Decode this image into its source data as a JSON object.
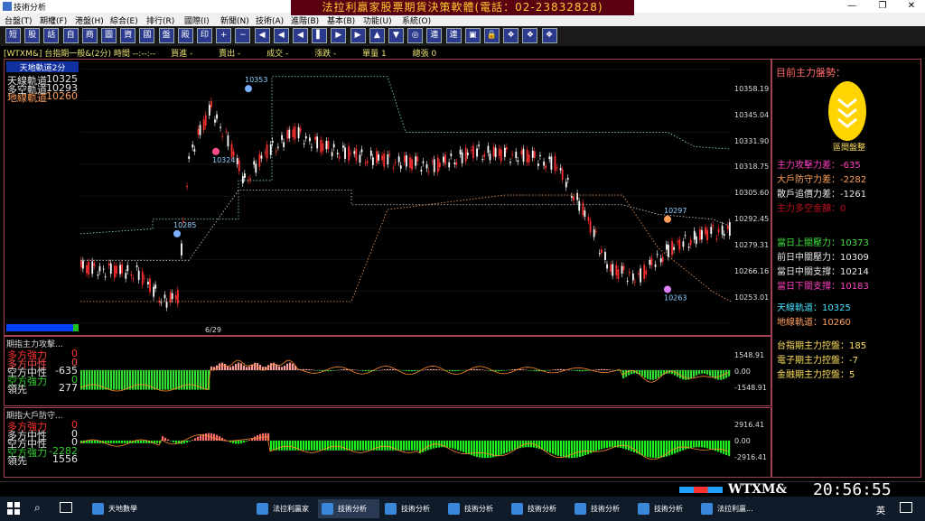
{
  "title": "技術分析",
  "banner": "法拉利贏家股票期貨決策軟體(電話：02-23832828)",
  "menu": [
    "台盤(T)",
    "期權(F)",
    "港盤(H)",
    "綜合(E)",
    "排行(R)",
    "國際(I)",
    "新聞(N)",
    "技術(A)",
    "進階(B)",
    "基本(B)",
    "功能(U)",
    "系統(O)"
  ],
  "toolbar": [
    "短",
    "股",
    "話",
    "自",
    "商",
    "圖",
    "資",
    "國",
    "盤",
    "殿",
    "印",
    "+",
    "−",
    "◀",
    "◀",
    "◀",
    "▌",
    "▶",
    "▶",
    "▲",
    "▼",
    "◎",
    "連",
    "連",
    "▣",
    "🔒",
    "❖",
    "❖",
    "❖"
  ],
  "info": {
    "symbol": "[WTXM&]",
    "name": "台指期一般&(2分) 時間 --:--:--",
    "buy": "買進 -",
    "sell": "賣出 -",
    "deal": "成交 -",
    "change": "漲跌 -",
    "volume": "單量 1",
    "total": "總張 0"
  },
  "main": {
    "legend_title": "天地軌道2分",
    "legend": [
      {
        "label": "天線軌道",
        "value": "10325",
        "color": "#e8e8e8"
      },
      {
        "label": "多空軌道",
        "value": "10293",
        "color": "#e8e8e8"
      },
      {
        "label": "地線軌道",
        "value": "10260",
        "color": "#ff9f5a"
      }
    ],
    "date_label": "6/29",
    "ylabels": [
      "10358.19",
      "10345.04",
      "10331.90",
      "10318.75",
      "10305.60",
      "10292.45",
      "10279.31",
      "10266.16",
      "10253.01"
    ],
    "annotations": [
      "10353",
      "10324",
      "10285",
      "10297",
      "10263"
    ]
  },
  "sub1": {
    "title": "期指主力攻擊...",
    "rows": [
      {
        "label": "多方強力",
        "value": "0",
        "color": "#ff3030"
      },
      {
        "label": "多方中性",
        "value": "0",
        "color": "#ff5050"
      },
      {
        "label": "空方中性",
        "value": "-635",
        "color": "#e8e8e8"
      },
      {
        "label": "空方強力",
        "value": "0",
        "color": "#30d030"
      },
      {
        "label": "領先",
        "value": "277",
        "color": "#e8e8e8"
      }
    ],
    "ylabels": [
      "1548.91",
      "0.00",
      "-1548.91"
    ]
  },
  "sub2": {
    "title": "期指大戶防守...",
    "rows": [
      {
        "label": "多方強力",
        "value": "0",
        "color": "#ff3030"
      },
      {
        "label": "多方中性",
        "value": "0",
        "color": "#e8e8e8"
      },
      {
        "label": "空方中性",
        "value": "0",
        "color": "#e8e8e8"
      },
      {
        "label": "空方強力",
        "value": "-2282",
        "color": "#30d030"
      },
      {
        "label": "領先",
        "value": "1556",
        "color": "#e8e8e8"
      }
    ],
    "ylabels": [
      "2916.41",
      "0.00",
      "-2916.41"
    ]
  },
  "right": {
    "title": "目前主力盤勢：",
    "emblem_label": "區間盤整",
    "stats": [
      {
        "label": "主力攻擊力差：",
        "value": "-635",
        "color": "#ff40c0"
      },
      {
        "label": "大戶防守力差：",
        "value": "-2282",
        "color": "#ff9f5a"
      },
      {
        "label": "散戶追價力差：",
        "value": "-1261",
        "color": "#e8e8e8"
      },
      {
        "label": "主力多空金額：",
        "value": "0",
        "color": "#c01020"
      },
      {
        "label": "當日上關壓力：",
        "value": "10373",
        "color": "#40e040"
      },
      {
        "label": "前日中關壓力：",
        "value": "10309",
        "color": "#e8e8e8"
      },
      {
        "label": "當日中關支撐：",
        "value": "10214",
        "color": "#e8e8e8"
      },
      {
        "label": "當日下關支撐：",
        "value": "10183",
        "color": "#ff40c0"
      },
      {
        "label": "天線軌道：",
        "value": "10325",
        "color": "#40e0ff"
      },
      {
        "label": "地線軌道：",
        "value": "10260",
        "color": "#ff9f5a"
      },
      {
        "label": "台指期主力控盤：",
        "value": "185",
        "color": "#ffe060"
      },
      {
        "label": "電子期主力控盤：",
        "value": "-7",
        "color": "#ffe060"
      },
      {
        "label": "金融期主力控盤：",
        "value": "5",
        "color": "#ffe060"
      }
    ]
  },
  "status": {
    "symbol": "WTXM&",
    "time": "20:56:55"
  },
  "taskbar": {
    "items": [
      "天地數學",
      "法拉利贏家",
      "技術分析",
      "技術分析",
      "技術分析",
      "技術分析",
      "技術分析",
      "技術分析",
      "法拉利贏..."
    ],
    "ime": "英"
  }
}
